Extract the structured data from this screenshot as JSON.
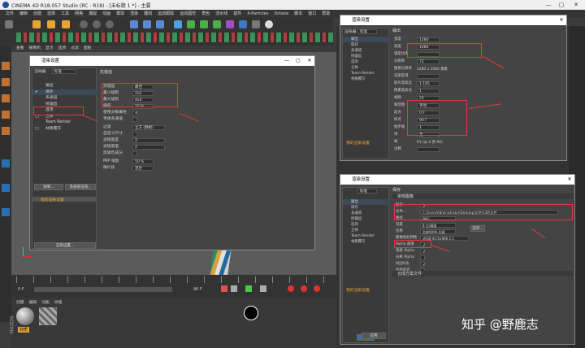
{
  "app": {
    "title": "CINEMA 4D R18.057 Studio (RC - R18) - [未标题 1 *] - 主要"
  },
  "menu": [
    "文件",
    "编辑",
    "创建",
    "选择",
    "工具",
    "网格",
    "捕捉",
    "动画",
    "模拟",
    "渲染",
    "雕刻",
    "运动跟踪",
    "运动图形",
    "角色",
    "流水线",
    "插件",
    "X-Particles",
    "Octane",
    "脚本",
    "窗口",
    "帮助"
  ],
  "viewport_menu": [
    "查看",
    "摄像机",
    "显示",
    "选项",
    "过滤",
    "面板"
  ],
  "dialog1": {
    "title": "渲染设置",
    "renderer_label": "渲染器",
    "renderer_value": "标准",
    "nav": [
      {
        "label": "输出",
        "check": ""
      },
      {
        "label": "保存",
        "check": "✔"
      },
      {
        "label": "多通道",
        "check": ""
      },
      {
        "label": "抗锯齿",
        "check": ""
      },
      {
        "label": "选项",
        "check": ""
      },
      {
        "label": "立体",
        "check": "□"
      },
      {
        "label": "Team Render",
        "check": ""
      },
      {
        "label": "材质覆写",
        "check": "□"
      }
    ],
    "effects_button": "效果...",
    "multipass_button": "多通道渲染...",
    "my_settings": "我的渲染设置",
    "settings_button": "渲染设置...",
    "section": "抗锯齿",
    "fields": [
      {
        "label": "抗锯齿",
        "value": "最佳"
      },
      {
        "label": "最小级别",
        "value": "2x2"
      },
      {
        "label": "最大级别",
        "value": "4x4"
      },
      {
        "label": "阈值",
        "value": "10 %"
      },
      {
        "label": "使用对象属性",
        "value": "✔"
      },
      {
        "label": "考虑多通道",
        "value": ""
      },
      {
        "label": "过滤",
        "value": "立方 (静帧)"
      },
      {
        "label": "自定义尺寸",
        "value": ""
      },
      {
        "label": "滤镜宽度",
        "value": "2"
      },
      {
        "label": "滤镜高度",
        "value": "2"
      },
      {
        "label": "剪辑负成分",
        "value": ""
      },
      {
        "label": "MIP 缩放",
        "value": "50 %"
      },
      {
        "label": "微片段",
        "value": "混合"
      }
    ]
  },
  "dialog2": {
    "title": "渲染设置",
    "renderer_value": "标准",
    "section": "输出",
    "nav": [
      "输出",
      "保存",
      "多通道",
      "抗锯齿",
      "选项",
      "立体",
      "Team Render",
      "材质覆写"
    ],
    "my_settings": "我的渲染设置",
    "fields": [
      {
        "label": "宽度",
        "value": "1280"
      },
      {
        "label": "高度",
        "value": "1080"
      },
      {
        "label": "锁定比率",
        "value": ""
      },
      {
        "label": "分辨率",
        "value": "72"
      },
      {
        "label": "图像分辨率",
        "value": "1280 x 1080 像素"
      },
      {
        "label": "渲染区域",
        "value": ""
      },
      {
        "label": "胶片宽高比",
        "value": "1.185"
      },
      {
        "label": "像素宽高比",
        "value": "1"
      },
      {
        "label": "帧频",
        "value": "25"
      },
      {
        "label": "帧范围",
        "value": "手动"
      },
      {
        "label": "起点",
        "value": "0 F"
      },
      {
        "label": "终点",
        "value": "90 F"
      },
      {
        "label": "帧步幅",
        "value": "1"
      },
      {
        "label": "场",
        "value": "无"
      },
      {
        "label": "帧",
        "value": "91 (从 0 到 90)"
      },
      {
        "label": "注释",
        "value": ""
      }
    ]
  },
  "dialog3": {
    "title": "渲染设置",
    "section": "保存",
    "sub1": "常规图像",
    "nav": [
      "输出",
      "保存",
      "多通道",
      "抗锯齿",
      "选项",
      "立体",
      "Team Render",
      "材质覆写"
    ],
    "fields": [
      {
        "label": "保存",
        "value": "✔"
      },
      {
        "label": "文件...",
        "value": "C:\\Users\\Administrator\\Desktop\\文件\\C4D\\文件"
      },
      {
        "label": "格式",
        "value": "PNG"
      },
      {
        "label": "深度",
        "value": "8 位/通道"
      },
      {
        "label": "名称",
        "value": "名称0000.后缀"
      },
      {
        "label": "图像色彩特性",
        "value": "sRGB IEC61966-2.1"
      },
      {
        "label": "Alpha 通道",
        "value": "✔"
      },
      {
        "label": "直接 Alpha",
        "value": "✔"
      },
      {
        "label": "分离 Alpha",
        "value": ""
      },
      {
        "label": "8位抖动",
        "value": "✔"
      },
      {
        "label": "包括声音",
        "value": ""
      }
    ],
    "options_button": "选项...",
    "sub2": "合成方案文件",
    "apply_button": "应用"
  },
  "timeline": {
    "start": "0 F",
    "end": "90 F",
    "current": "0 F"
  },
  "material_tabs": [
    "创建",
    "编辑",
    "功能",
    "纹理"
  ],
  "material_name": "材质",
  "watermark": "知乎 @野鹿志",
  "colors": {
    "red": "#e23a3a",
    "accent": "#f0a030",
    "dialog_bg": "#444444"
  }
}
